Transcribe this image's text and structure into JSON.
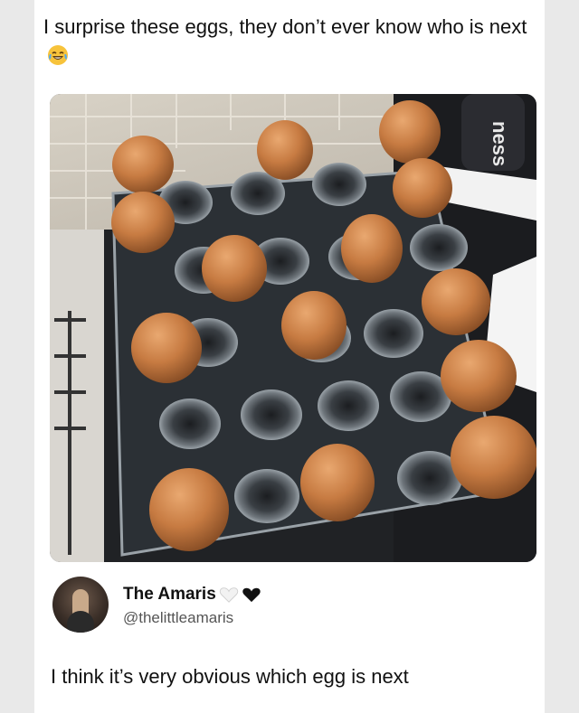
{
  "post": {
    "text": "I surprise these eggs, they don’t ever know who is next",
    "emoji_icon": "laughing-crying-emoji"
  },
  "photo": {
    "subject": "egg-carton-photo",
    "bottle_label": "ness"
  },
  "reply": {
    "display_name": "The Amaris",
    "handle": "@thelittleamaris",
    "badges": [
      "white-heart-icon",
      "black-heart-icon"
    ],
    "text": "I think it’s very obvious which egg is next"
  }
}
